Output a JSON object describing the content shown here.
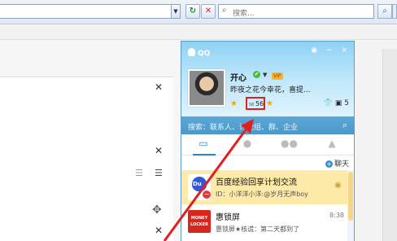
{
  "browser": {
    "search_placeholder": "搜索...",
    "refresh_glyph": "↻",
    "stop_glyph": "✕",
    "search_icon": "magnifier-icon"
  },
  "page": {
    "close_glyph": "✕",
    "list_glyph": "☰",
    "move_glyph": "✥"
  },
  "qq": {
    "title": "QQ",
    "window_buttons": "◉ − ×",
    "profile": {
      "nickname": "开心",
      "status": "✔",
      "dropdown": "▼",
      "vip_label": "VIP",
      "signature": "昨夜之花今幸花，喜提...",
      "mail_count": "56",
      "right_count": "5"
    },
    "search_hint": "搜索：联系人、讨论组、群、企业",
    "chat_button": "聊天",
    "items": [
      {
        "title": "百度经验回享计划交流",
        "subtitle": "ID：小洋洋小洋:@岁月无声boy",
        "time": ""
      },
      {
        "title": "惠锁屏",
        "subtitle": "惠锁屏★核谎：第二天都到了",
        "time": "8:38",
        "logo_text": "MONEY LOCKER"
      }
    ]
  },
  "colors": {
    "accent_blue": "#2a86c7",
    "highlight_red": "#e02020",
    "item_highlight": "#fde9a8"
  }
}
